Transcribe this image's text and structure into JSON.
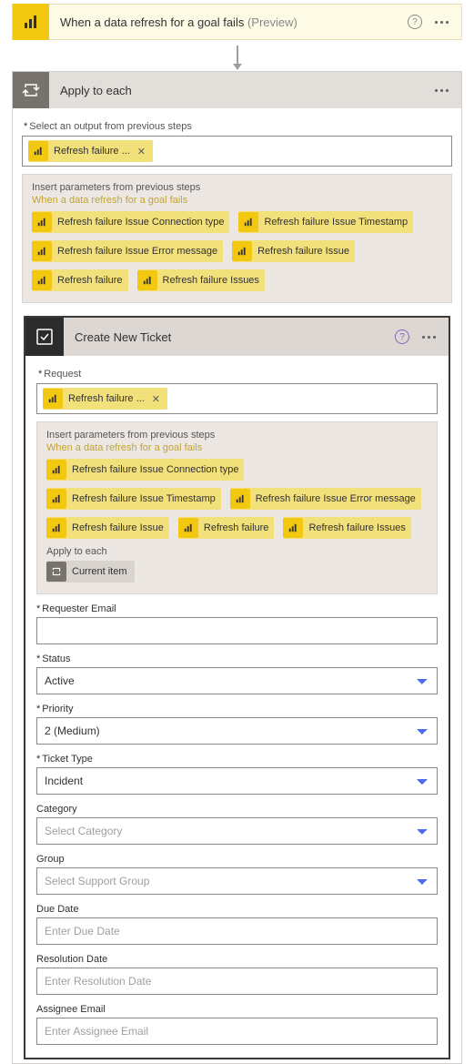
{
  "trigger": {
    "title": "When a data refresh for a goal fails",
    "suffix": "(Preview)"
  },
  "applyToEach": {
    "title": "Apply to each",
    "selectLabel": "Select an output from previous steps",
    "selectedToken": "Refresh failure ...",
    "insertPanel": {
      "title": "Insert parameters from previous steps",
      "source": "When a data refresh for a goal fails",
      "params": [
        "Refresh failure Issue Connection type",
        "Refresh failure Issue Timestamp",
        "Refresh failure Issue Error message",
        "Refresh failure Issue",
        "Refresh failure",
        "Refresh failure Issues"
      ]
    }
  },
  "createTicket": {
    "title": "Create New Ticket",
    "requestLabel": "Request",
    "requestToken": "Refresh failure ...",
    "insertPanel": {
      "title": "Insert parameters from previous steps",
      "source": "When a data refresh for a goal fails",
      "params": [
        "Refresh failure Issue Connection type",
        "Refresh failure Issue Timestamp",
        "Refresh failure Issue Error message",
        "Refresh failure Issue",
        "Refresh failure",
        "Refresh failure Issues"
      ],
      "applyLabel": "Apply to each",
      "applyToken": "Current item"
    },
    "fields": {
      "requesterEmail": {
        "label": "Requester Email",
        "value": "",
        "required": true
      },
      "status": {
        "label": "Status",
        "value": "Active",
        "required": true
      },
      "priority": {
        "label": "Priority",
        "value": "2 (Medium)",
        "required": true
      },
      "ticketType": {
        "label": "Ticket Type",
        "value": "Incident",
        "required": true
      },
      "category": {
        "label": "Category",
        "placeholder": "Select Category"
      },
      "group": {
        "label": "Group",
        "placeholder": "Select Support Group"
      },
      "dueDate": {
        "label": "Due Date",
        "placeholder": "Enter Due Date"
      },
      "resolutionDate": {
        "label": "Resolution Date",
        "placeholder": "Enter Resolution Date"
      },
      "assigneeEmail": {
        "label": "Assignee Email",
        "placeholder": "Enter Assignee Email"
      }
    }
  }
}
